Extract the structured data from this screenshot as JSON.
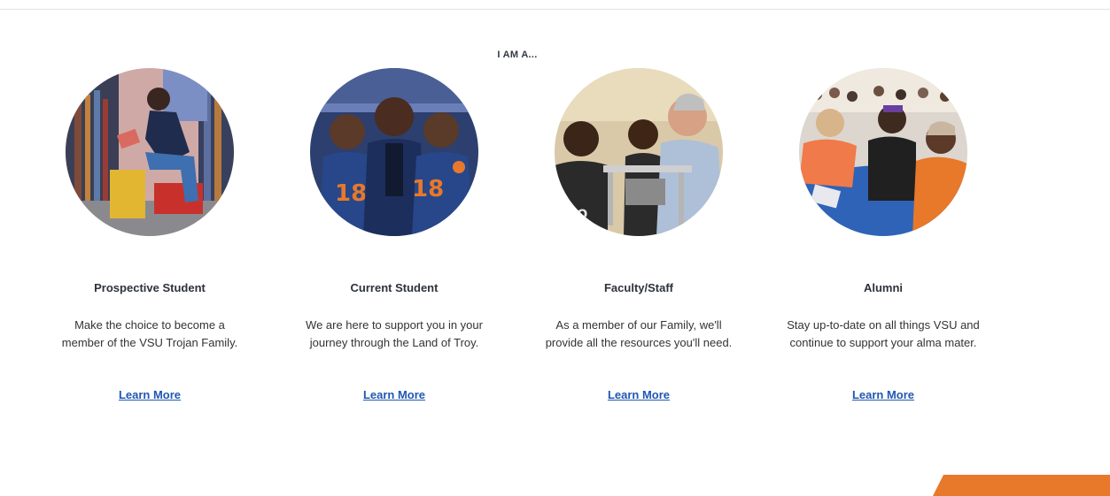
{
  "section": {
    "eyebrow": "I AM A..."
  },
  "cards": [
    {
      "title": "Prospective Student",
      "desc_line1": "Make the choice to become a",
      "desc_line2": "member of the VSU Trojan Family.",
      "link": "Learn More"
    },
    {
      "title": "Current Student",
      "desc_line1": "We are here to support you in your",
      "desc_line2": "journey through the Land of Troy.",
      "link": "Learn More"
    },
    {
      "title": "Faculty/Staff",
      "desc_line1": "As a member of our Family, we'll",
      "desc_line2": "provide all the resources you'll need.",
      "link": "Learn More"
    },
    {
      "title": "Alumni",
      "desc_line1": "Stay up-to-date on all things VSU and",
      "desc_line2": "continue to support your alma mater.",
      "link": "Learn More"
    }
  ],
  "colors": {
    "link": "#1f57b3",
    "accent_orange": "#e8782a",
    "navy": "#1e3c78"
  }
}
